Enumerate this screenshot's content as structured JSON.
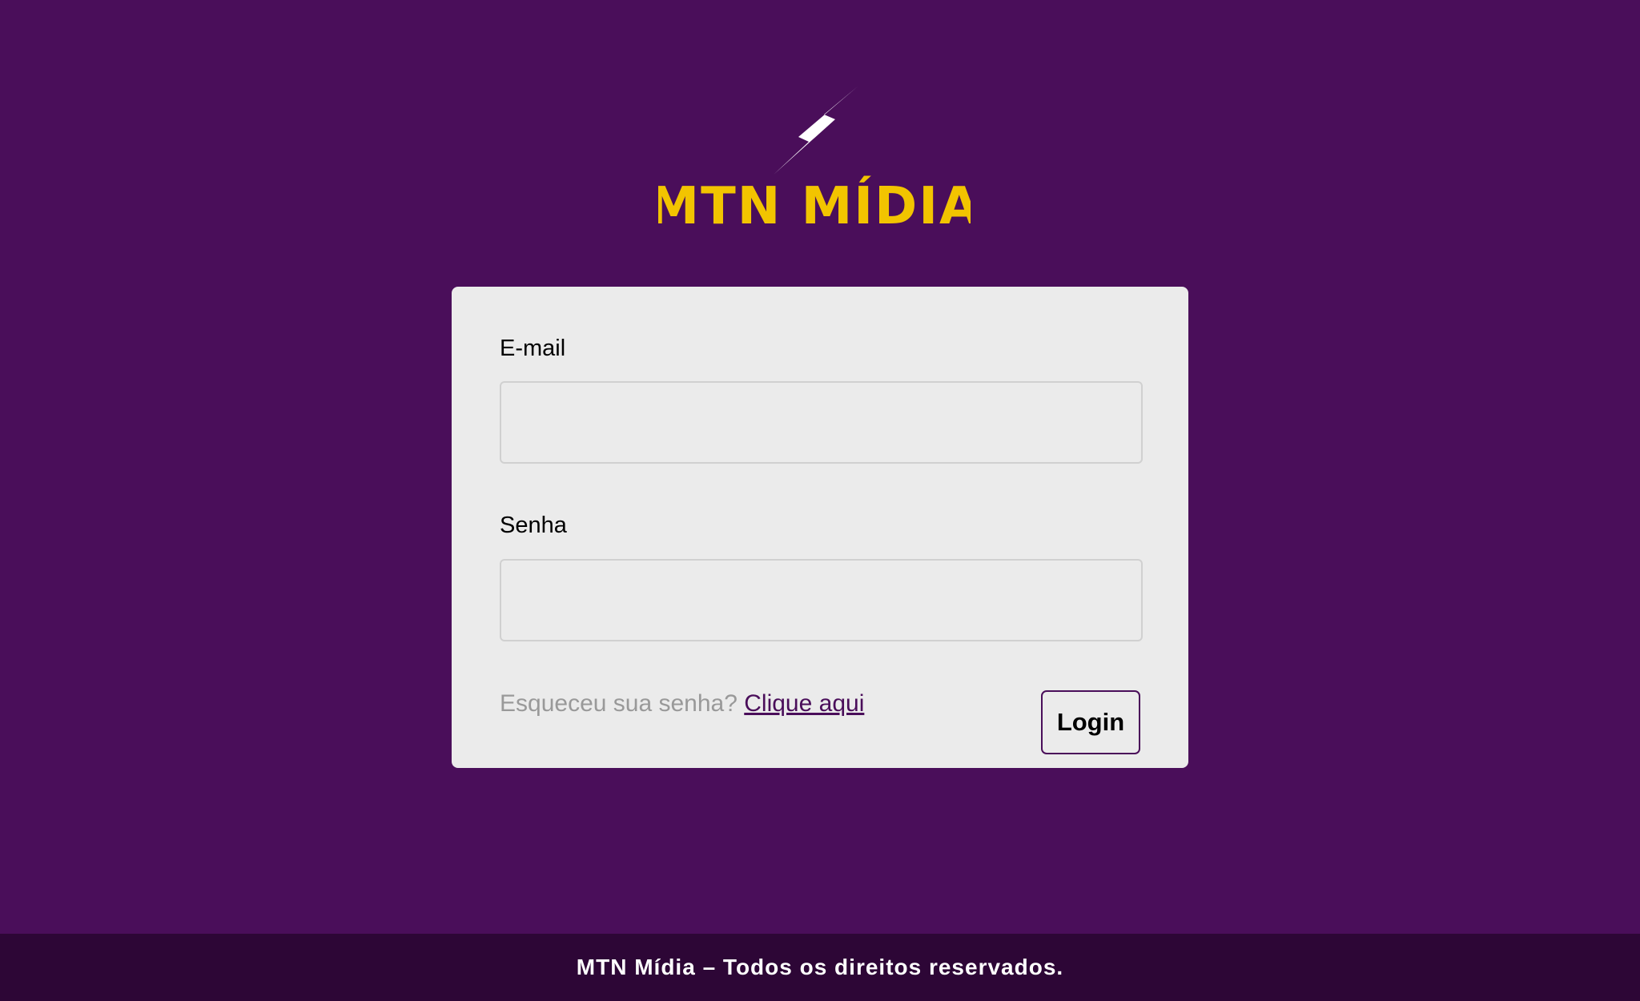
{
  "brand": {
    "name": "MTN MÍDIA",
    "logo_color": "#f2c400",
    "bolt_color": "#ffffff"
  },
  "colors": {
    "background": "#4a0e5a",
    "card": "#ebebeb",
    "footer": "#2d0636",
    "link": "#4a0e5a"
  },
  "form": {
    "email_label": "E-mail",
    "email_value": "",
    "email_placeholder": "",
    "password_label": "Senha",
    "password_value": "",
    "password_placeholder": "",
    "forgot_text": "Esqueceu sua senha?",
    "forgot_link": "Clique aqui",
    "login_button": "Login"
  },
  "footer": {
    "text": "MTN Mídia – Todos os direitos reservados."
  }
}
